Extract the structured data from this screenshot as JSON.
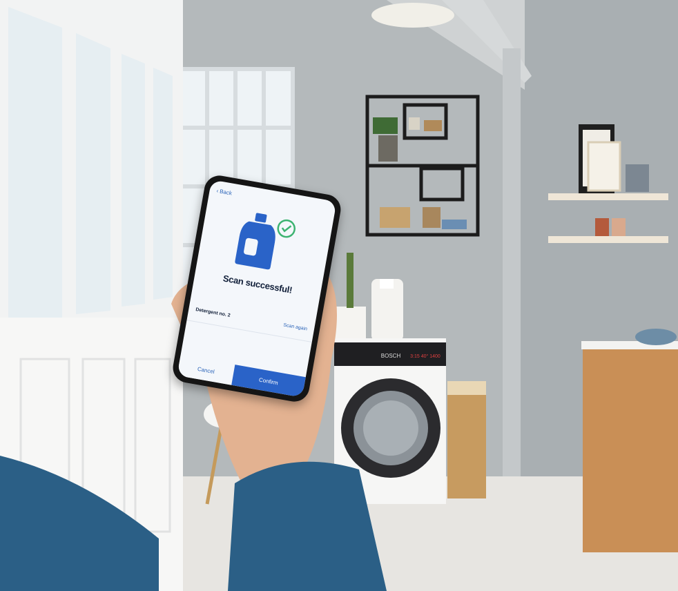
{
  "phone_app": {
    "back_label": "Back",
    "status_title": "Scan successful!",
    "detergent_name": "Detergent no. 2",
    "scan_again_label": "Scan again",
    "cancel_label": "Cancel",
    "confirm_label": "Confirm"
  },
  "washer_display": {
    "brand_label": "BOSCH",
    "readout": "3:15 40° 1400"
  },
  "colors": {
    "app_accent": "#2a63c8",
    "check_green": "#3cb371",
    "sweater_blue": "#2b5f86",
    "wall_grey": "#b7bcbf"
  }
}
